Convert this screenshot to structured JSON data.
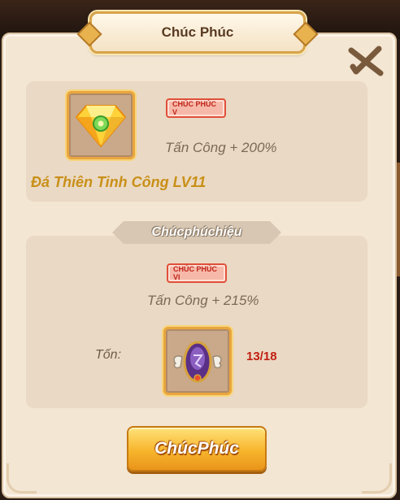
{
  "dialog": {
    "title": "Chúc Phúc",
    "close_icon": "close-x-icon"
  },
  "current": {
    "item_icon": "gem-icon",
    "item_name": "Đá Thiên Tinh Công LV11",
    "badge": "CHÚC PHÚC V",
    "stat": "Tấn Công + 200%"
  },
  "effect_section": {
    "title": "Chúcphúchiệu",
    "badge": "CHÚC PHÚC VI",
    "stat": "Tấn Công + 215%",
    "cost_label": "Tốn:",
    "cost_item_icon": "winged-crystal-icon",
    "cost_count": "13/18"
  },
  "action": {
    "label": "ChúcPhúc"
  },
  "colors": {
    "panel": "#f3e6d3",
    "accent_gold": "#e9a63d",
    "badge_red": "#c0241a",
    "count_red": "#c11e10",
    "item_name_gold": "#c99018"
  }
}
